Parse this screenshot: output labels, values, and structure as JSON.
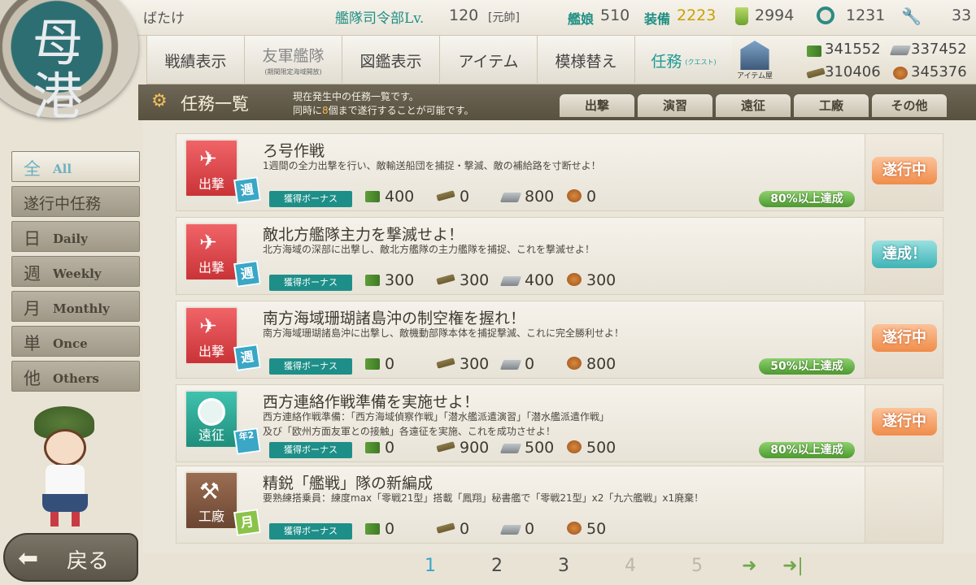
{
  "header": {
    "player_name": "ばたけ",
    "hq_level_label": "艦隊司令部Lv.",
    "hq_level": "120",
    "rank": "[元帥]",
    "ships_label": "艦娘",
    "ships_count": "510",
    "equip_label": "装備",
    "equip_count": "2223",
    "buckets": "2994",
    "dev_materials": "1231",
    "screws": "33"
  },
  "resources": {
    "fuel": "341552",
    "ammo": "310406",
    "steel": "337452",
    "bauxite": "345376",
    "shop_label": "アイテム屋"
  },
  "menu": [
    {
      "label": "戦績表示",
      "sub": ""
    },
    {
      "label": "友軍艦隊",
      "sub": "(期間限定海域開放)"
    },
    {
      "label": "図鑑表示",
      "sub": ""
    },
    {
      "label": "アイテム",
      "sub": ""
    },
    {
      "label": "模様替え",
      "sub": ""
    },
    {
      "label": "任務",
      "sub": "(クエスト)"
    }
  ],
  "quest_header": {
    "title": "任務一覧",
    "info_line1": "現在発生中の任務一覧です。",
    "info_line2_pre": "同時に",
    "info_line2_num": "8",
    "info_line2_post": "個まで遂行することが可能です。",
    "tabs": [
      "出撃",
      "演習",
      "遠征",
      "工廠",
      "その他"
    ]
  },
  "filters": [
    {
      "kanji": "全",
      "en": "All"
    },
    {
      "kanji": "遂行中任務",
      "en": ""
    },
    {
      "kanji": "日",
      "en": "Daily"
    },
    {
      "kanji": "週",
      "en": "Weekly"
    },
    {
      "kanji": "月",
      "en": "Monthly"
    },
    {
      "kanji": "単",
      "en": "Once"
    },
    {
      "kanji": "他",
      "en": "Others"
    }
  ],
  "bonus_label": "獲得ボーナス",
  "quests": [
    {
      "category": "出撃",
      "category_color": "#e2474b",
      "frequency": "週",
      "title": "ろ号作戦",
      "desc1": "1週間の全力出撃を行い、敵輸送船団を捕捉・撃滅、敵の補給路を寸断せよ！",
      "desc2": "",
      "fuel": "400",
      "ammo": "0",
      "steel": "800",
      "bauxite": "0",
      "progress": "80%以上達成",
      "state": "遂行中",
      "state_type": "going"
    },
    {
      "category": "出撃",
      "category_color": "#e2474b",
      "frequency": "週",
      "title": "敵北方艦隊主力を撃滅せよ！",
      "desc1": "北方海域の深部に出撃し、敵北方艦隊の主力艦隊を捕捉、これを撃滅せよ！",
      "desc2": "",
      "fuel": "300",
      "ammo": "300",
      "steel": "400",
      "bauxite": "300",
      "progress": "",
      "state": "達成！",
      "state_type": "done"
    },
    {
      "category": "出撃",
      "category_color": "#e2474b",
      "frequency": "週",
      "title": "南方海域珊瑚諸島沖の制空権を握れ！",
      "desc1": "南方海域珊瑚諸島沖に出撃し、敵機動部隊本体を捕捉撃滅、これに完全勝利せよ！",
      "desc2": "",
      "fuel": "0",
      "ammo": "300",
      "steel": "0",
      "bauxite": "800",
      "progress": "50%以上達成",
      "state": "遂行中",
      "state_type": "going"
    },
    {
      "category": "遠征",
      "category_color": "#2fa592",
      "frequency": "年2",
      "title": "西方連絡作戦準備を実施せよ！",
      "desc1": "西方連絡作戦準備：「西方海域偵察作戦」「潜水艦派遣演習」「潜水艦派遣作戦」",
      "desc2": "及び「欧州方面友軍との接触」各遠征を実施、これを成功させよ！",
      "fuel": "0",
      "ammo": "900",
      "steel": "500",
      "bauxite": "500",
      "progress": "80%以上達成",
      "state": "遂行中",
      "state_type": "going"
    },
    {
      "category": "工廠",
      "category_color": "#7a5540",
      "frequency": "月",
      "title": "精鋭「艦戦」隊の新編成",
      "desc1": "要熟練搭乗員：練度max「零戦21型」搭載「鳳翔」秘書艦で「零戦21型」x2「九六艦戦」x1廃棄！",
      "desc2": "",
      "fuel": "0",
      "ammo": "0",
      "steel": "0",
      "bauxite": "50",
      "progress": "",
      "state": "",
      "state_type": ""
    }
  ],
  "pager": {
    "pages": [
      "1",
      "2",
      "3",
      "4",
      "5"
    ],
    "current": "1"
  },
  "back_label": "戻る"
}
